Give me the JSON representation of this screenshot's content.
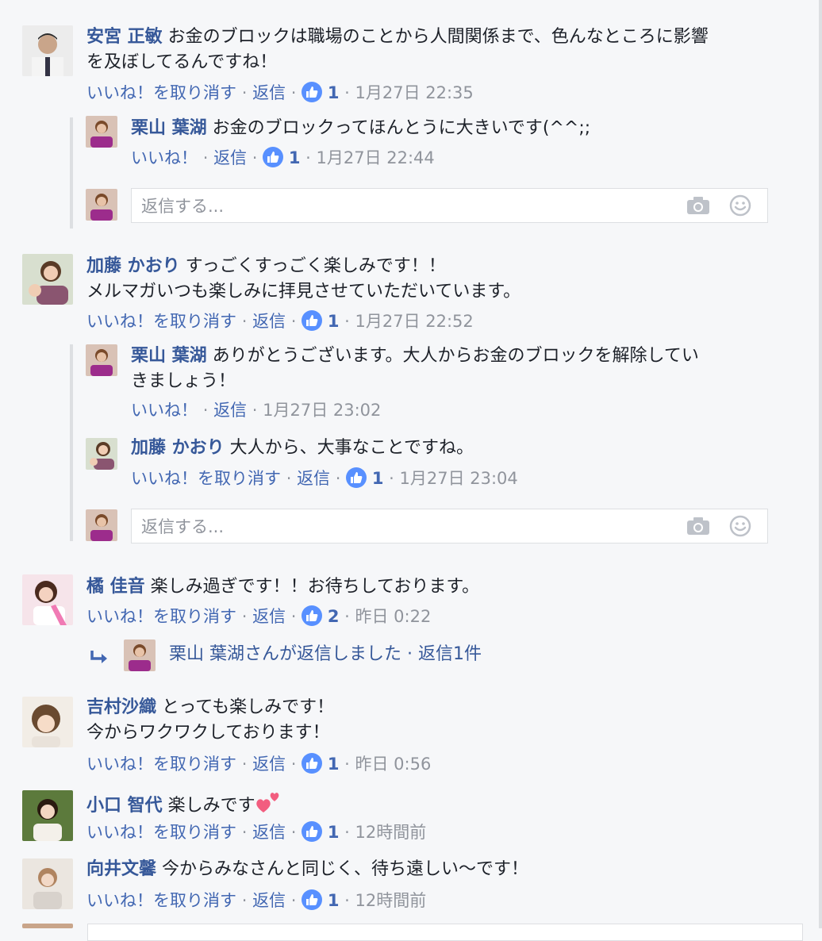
{
  "actions": {
    "like": "いいね！",
    "unlike": "いいね！を取り消す",
    "reply": "返信",
    "dot": "·",
    "reply_placeholder": "返信する..."
  },
  "comments": [
    {
      "author": "安宮 正敏",
      "text_line1": "お金のブロックは職場のことから人間関係まで、色んなところに影響",
      "text_line2": "を及ぼしてるんですね！",
      "likes": "1",
      "time": "1月27日 22:35"
    },
    {
      "author": "栗山 葉湖",
      "text": "お金のブロックってほんとうに大きいです(^^;;",
      "likes": "1",
      "time": "1月27日 22:44"
    },
    {
      "author": "加藤 かおり",
      "text_line1": "すっごくすっごく楽しみです！！",
      "text_line2": "メルマガいつも楽しみに拝見させていただいています。",
      "likes": "1",
      "time": "1月27日 22:52"
    },
    {
      "author": "栗山 葉湖",
      "text_line1": "ありがとうございます。大人からお金のブロックを解除してい",
      "text_line2": "きましょう！",
      "time": "1月27日 23:02"
    },
    {
      "author": "加藤 かおり",
      "text": "大人から、大事なことですね。",
      "likes": "1",
      "time": "1月27日 23:04"
    },
    {
      "author": "橘 佳音",
      "text": "楽しみ過ぎです！！お待ちしております。",
      "likes": "2",
      "time": "昨日 0:22",
      "reply_summary": "栗山 葉湖さんが返信しました · 返信1件"
    },
    {
      "author": "吉村沙織",
      "text_line1": "とっても楽しみです！",
      "text_line2": "今からワクワクしております！",
      "likes": "1",
      "time": "昨日 0:56"
    },
    {
      "author": "小口 智代",
      "text": "楽しみです",
      "likes": "1",
      "time": "12時間前"
    },
    {
      "author": "向井文馨",
      "text": "今からみなさんと同じく、待ち遠しい〜です！",
      "likes": "1",
      "time": "12時間前"
    }
  ]
}
